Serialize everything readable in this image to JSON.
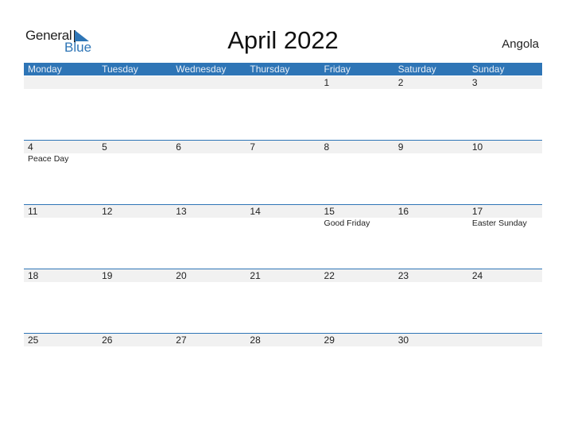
{
  "logo": {
    "line1": "General",
    "line2": "Blue"
  },
  "title": "April 2022",
  "country": "Angola",
  "weekdays": [
    "Monday",
    "Tuesday",
    "Wednesday",
    "Thursday",
    "Friday",
    "Saturday",
    "Sunday"
  ],
  "weeks": [
    [
      {
        "day": ""
      },
      {
        "day": ""
      },
      {
        "day": ""
      },
      {
        "day": ""
      },
      {
        "day": "1"
      },
      {
        "day": "2"
      },
      {
        "day": "3"
      }
    ],
    [
      {
        "day": "4",
        "event": "Peace Day"
      },
      {
        "day": "5"
      },
      {
        "day": "6"
      },
      {
        "day": "7"
      },
      {
        "day": "8"
      },
      {
        "day": "9"
      },
      {
        "day": "10"
      }
    ],
    [
      {
        "day": "11"
      },
      {
        "day": "12"
      },
      {
        "day": "13"
      },
      {
        "day": "14"
      },
      {
        "day": "15",
        "event": "Good Friday"
      },
      {
        "day": "16"
      },
      {
        "day": "17",
        "event": "Easter Sunday"
      }
    ],
    [
      {
        "day": "18"
      },
      {
        "day": "19"
      },
      {
        "day": "20"
      },
      {
        "day": "21"
      },
      {
        "day": "22"
      },
      {
        "day": "23"
      },
      {
        "day": "24"
      }
    ],
    [
      {
        "day": "25"
      },
      {
        "day": "26"
      },
      {
        "day": "27"
      },
      {
        "day": "28"
      },
      {
        "day": "29"
      },
      {
        "day": "30"
      },
      {
        "day": ""
      }
    ]
  ],
  "colors": {
    "accent": "#2e75b6",
    "strip": "#f1f1f1"
  }
}
